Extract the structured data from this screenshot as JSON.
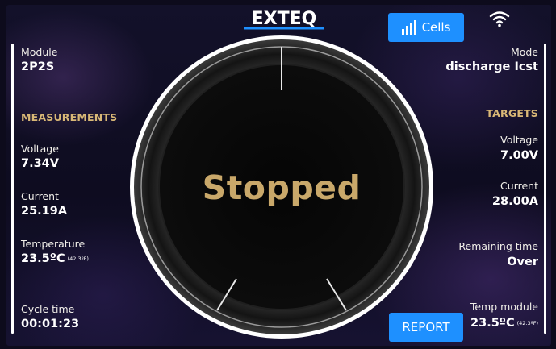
{
  "brand": "EXTEQ",
  "header": {
    "cells_label": "Cells"
  },
  "left": {
    "module_label": "Module",
    "module_value": "2P2S",
    "section_title": "MEASUREMENTS",
    "voltage_label": "Voltage",
    "voltage_value": "7.34V",
    "current_label": "Current",
    "current_value": "25.19A",
    "temperature_label": "Temperature",
    "temperature_value": "23.5ºC",
    "temperature_f": "(42.3ºF)",
    "cycle_label": "Cycle time",
    "cycle_value": "00:01:23"
  },
  "right": {
    "mode_label": "Mode",
    "mode_value": "discharge Icst",
    "section_title": "TARGETS",
    "voltage_label": "Voltage",
    "voltage_value": "7.00V",
    "current_label": "Current",
    "current_value": "28.00A",
    "remaining_label": "Remaining time",
    "remaining_value": "Over",
    "temp_module_label": "Temp module",
    "temp_module_value": "23.5ºC",
    "temp_module_f": "(42.3ºF)"
  },
  "center": {
    "status": "Stopped"
  },
  "footer": {
    "report_label": "REPORT"
  },
  "colors": {
    "accent_button": "#1e90ff",
    "gold": "#c9a86a",
    "section_gold": "#d9b876"
  },
  "icons": {
    "wifi": "wifi-icon",
    "bars": "signal-bars-icon"
  }
}
